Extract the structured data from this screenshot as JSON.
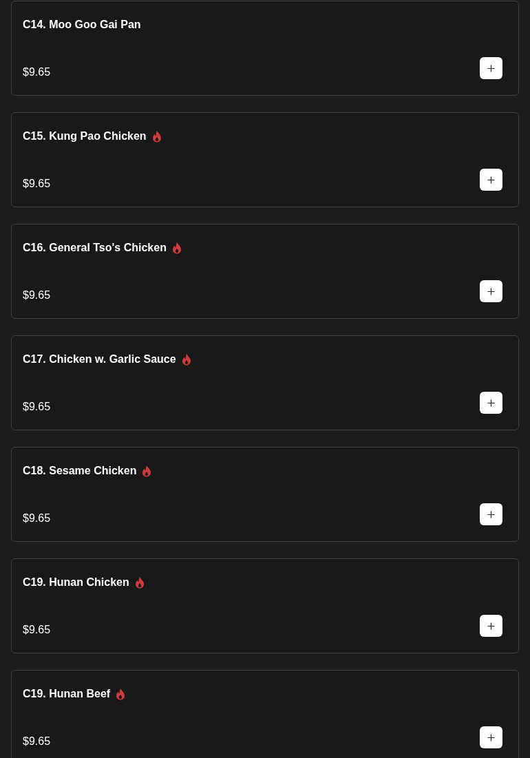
{
  "items": [
    {
      "name": "C14. Moo Goo Gai Pan",
      "spicy": false,
      "price": "$9.65"
    },
    {
      "name": "C15. Kung Pao Chicken",
      "spicy": true,
      "price": "$9.65"
    },
    {
      "name": "C16. General Tso's Chicken",
      "spicy": true,
      "price": "$9.65"
    },
    {
      "name": "C17. Chicken w. Garlic Sauce",
      "spicy": true,
      "price": "$9.65"
    },
    {
      "name": "C18. Sesame Chicken",
      "spicy": true,
      "price": "$9.65"
    },
    {
      "name": "C19. Hunan Chicken",
      "spicy": true,
      "price": "$9.65"
    },
    {
      "name": "C19. Hunan Beef",
      "spicy": true,
      "price": "$9.65"
    }
  ]
}
